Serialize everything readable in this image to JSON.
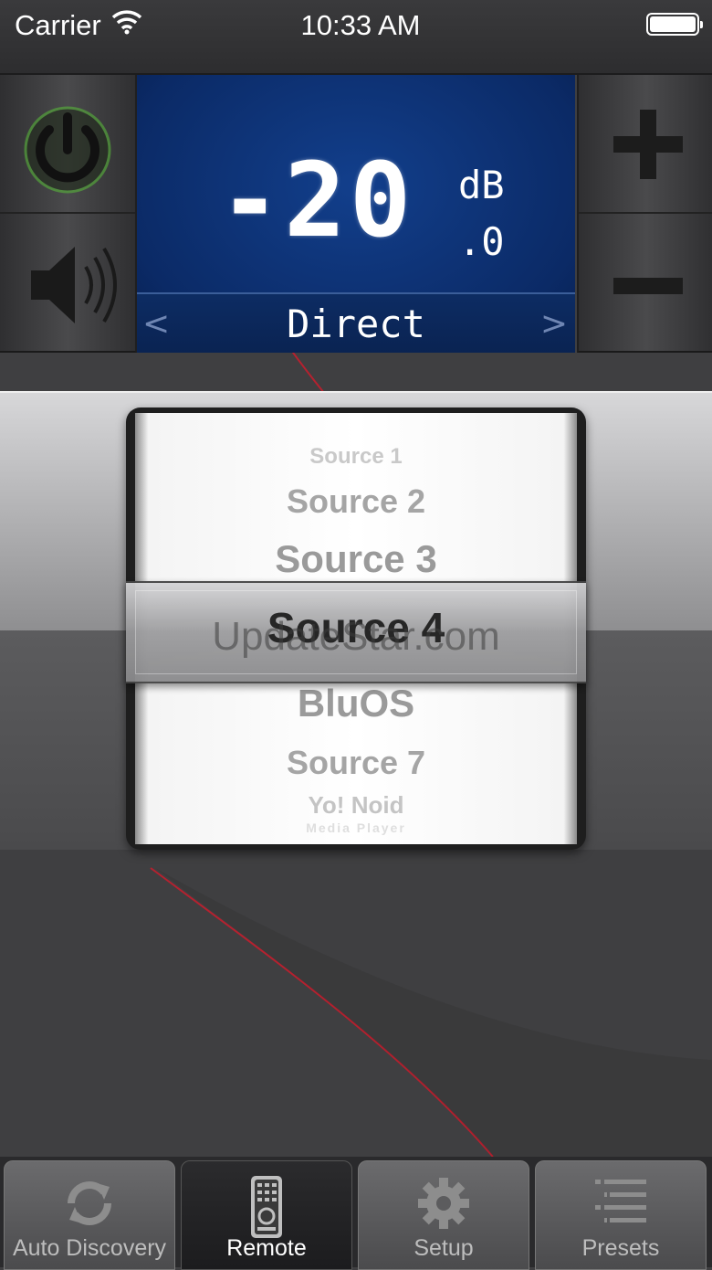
{
  "status_bar": {
    "carrier": "Carrier",
    "time": "10:33 AM"
  },
  "display": {
    "volume": "-20",
    "unit": "dB",
    "decimal": ".0",
    "mode": "Direct",
    "prev_symbol": "<",
    "next_symbol": ">"
  },
  "colors": {
    "accent_red": "#b5212f",
    "display_blue": "#0b2a66",
    "power_green": "#57b43a"
  },
  "picker": {
    "items_above": [
      "Source 1",
      "Source 2",
      "Source 3"
    ],
    "selected": "Source 4",
    "items_below": [
      "BluOS",
      "Source 7",
      "Yo! Noid",
      "Media Player"
    ]
  },
  "watermark": "UpdateStar.com",
  "tabs": [
    {
      "label": "Auto Discovery",
      "icon": "refresh-icon"
    },
    {
      "label": "Remote",
      "icon": "remote-icon",
      "active": true
    },
    {
      "label": "Setup",
      "icon": "gear-icon"
    },
    {
      "label": "Presets",
      "icon": "list-icon"
    }
  ]
}
